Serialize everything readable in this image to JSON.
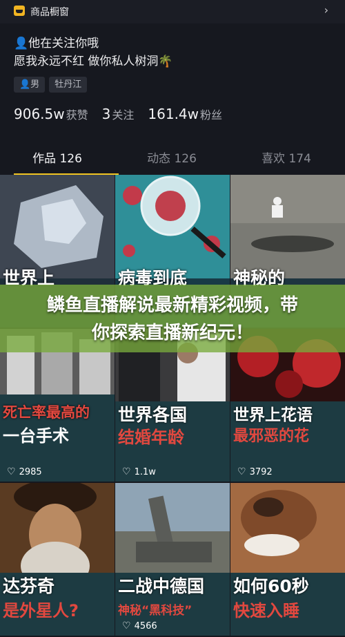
{
  "topbar": {
    "shop_label": "商品橱窗",
    "chevron": "›"
  },
  "profile": {
    "bio_line1": "👤他在关注你哦",
    "bio_line2": "愿我永远不红 做你私人树洞🌴",
    "tags": [
      "👤男",
      "牡丹江"
    ],
    "stats": [
      {
        "num": "906.5w",
        "label": "获赞"
      },
      {
        "num": "3",
        "label": "关注"
      },
      {
        "num": "161.4w",
        "label": "粉丝"
      }
    ]
  },
  "tabs": [
    {
      "label": "作品 126",
      "active": true
    },
    {
      "label": "动态 126",
      "active": false
    },
    {
      "label": "喜欢 174",
      "active": false
    }
  ],
  "videos": [
    {
      "cap1": "世界上",
      "cap2": "",
      "likes": "",
      "icon": "crystal-thumbnail"
    },
    {
      "cap1": "病毒到底",
      "cap2": "",
      "likes": "",
      "icon": "virus-thumbnail"
    },
    {
      "cap1": "神秘的",
      "cap2": "",
      "likes": "",
      "icon": "desert-thumbnail"
    },
    {
      "cap1": "死亡率最高的",
      "cap2": "一台手术",
      "likes": "2985",
      "icon": "surgery-photo-thumbnail"
    },
    {
      "cap1": "世界各国",
      "cap2": "结婚年龄",
      "likes": "1.1w",
      "icon": "wedding-thumbnail"
    },
    {
      "cap1": "世界上花语",
      "cap2": "最邪恶的花",
      "likes": "3792",
      "icon": "red-flower-thumbnail"
    },
    {
      "cap1": "达芬奇",
      "cap2": "是外星人?",
      "likes": "",
      "icon": "davinci-thumbnail"
    },
    {
      "cap1": "二战中德国",
      "cap2": "神秘“黑科技”",
      "likes": "4566",
      "icon": "cannon-thumbnail"
    },
    {
      "cap1": "如何60秒",
      "cap2": "快速入睡",
      "likes": "",
      "icon": "dog-thumbnail"
    }
  ],
  "banner": {
    "line1": "鳞鱼直播解说最新精彩视频，带",
    "line2": "你探索直播新纪元！"
  },
  "colors": {
    "accent": "#f2c521",
    "background": "#16181f",
    "caption_red": "#e2483f",
    "banner_green": "#78aa3c"
  }
}
